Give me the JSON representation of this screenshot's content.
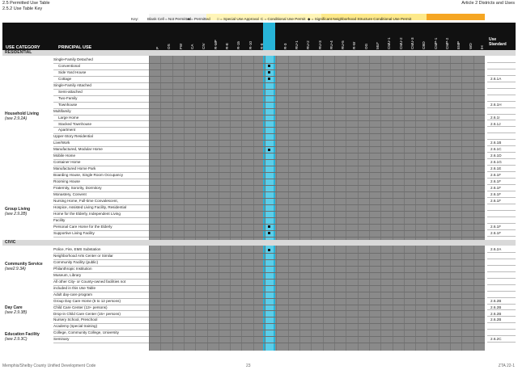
{
  "header": {
    "left_line1": "2.5 Permitted Use Table",
    "left_line2": "2.5.2 Use Table Key",
    "right": "Article 2 Districts and Uses"
  },
  "key": {
    "label": "Key:",
    "blank": "Blank Cell = Not Permitted",
    "permitted": "■ = Permitted",
    "special": "□ = Special Use Approval",
    "conditional": "C = Conditional Use Permit",
    "significant": "◆ = Significant Neighborhood Structure Conditional Use Permit"
  },
  "table_header": {
    "use_category": "USE CATEGORY",
    "principal_use": "PRINCIPAL USE",
    "use_standard": "Use Standard"
  },
  "zones": [
    "P",
    "OS",
    "FW",
    "CA",
    "CIV",
    "R-MP",
    "R-E",
    "R-15",
    "R-10",
    "R-8",
    "R-6",
    "R-3",
    "RU-1",
    "RU-2",
    "RU-3",
    "RU-4",
    "RU-5",
    "R-W",
    "OG",
    "MU*",
    "CMU-1",
    "CMU-2",
    "CMU-3",
    "CBD",
    "CMP-1",
    "CMP-2",
    "EMP",
    "WD",
    "IH"
  ],
  "sections": [
    "RESIDENTIAL",
    "CIVIC"
  ],
  "categories": [
    {
      "name": "Household Living",
      "ref": "(see 2.9.2A)"
    },
    {
      "name": "Group Living",
      "ref": "(see 2.9.2B)"
    },
    {
      "name": "Community Service",
      "ref": "(see2.9.3A)"
    },
    {
      "name": "Day Care",
      "ref": "(see 2.9.3B)"
    },
    {
      "name": "Education Facility",
      "ref": "(see 2.9.3C)"
    }
  ],
  "rows": [
    {
      "use": "Single-Family Detached",
      "std": ""
    },
    {
      "use": "Conventional",
      "std": ""
    },
    {
      "use": "Side Yard House",
      "std": ""
    },
    {
      "use": "Cottage",
      "std": "2.6.1A"
    },
    {
      "use": "Single-Family Attached",
      "std": ""
    },
    {
      "use": "Semi-attached",
      "std": ""
    },
    {
      "use": "Two-Family",
      "std": ""
    },
    {
      "use": "Townhouse",
      "std": "2.6.1H"
    },
    {
      "use": "Multifamily",
      "std": ""
    },
    {
      "use": "Large Home",
      "std": "2.6.1I"
    },
    {
      "use": "Stacked Townhouse",
      "std": "2.6.1J"
    },
    {
      "use": "Apartment",
      "std": ""
    },
    {
      "use": "Upper-Story Residential",
      "std": ""
    },
    {
      "use": "Live/Work",
      "std": "2.6.1B"
    },
    {
      "use": "Manufactured, Modular Home",
      "std": "2.6.1C"
    },
    {
      "use": "Mobile Home",
      "std": "2.6.1D"
    },
    {
      "use": "Container Home",
      "std": "2.6.1G"
    },
    {
      "use": "Manufactured Home Park",
      "std": "2.6.1E"
    },
    {
      "use": "Boarding House, Single Room Occupancy",
      "std": "2.6.1F"
    },
    {
      "use": "Rooming House",
      "std": "2.6.1F"
    },
    {
      "use": "Fraternity, Sorority, Dormitory",
      "std": "2.6.1F"
    },
    {
      "use": "Monastery, Convent",
      "std": "2.6.1F"
    },
    {
      "use": "Nursing Home, Full-time Convalescent,",
      "std": "2.6.1F"
    },
    {
      "use": "Hospice, Assisted Living Facility, Residential",
      "std": ""
    },
    {
      "use": "Home for the Elderly, Independent Living",
      "std": ""
    },
    {
      "use": "Facility",
      "std": ""
    },
    {
      "use": "Personal Care Home for the Elderly",
      "std": "2.6.1F"
    },
    {
      "use": "Supportive Living Facility",
      "std": "2.6.1F"
    },
    {
      "use": "Police, Fire, EMS Substation",
      "std": "2.6.2A"
    },
    {
      "use": "Neighborhood Arts Center or Similar",
      "std": ""
    },
    {
      "use": "Community Facility (public)",
      "std": ""
    },
    {
      "use": "Philanthropic Institution",
      "std": ""
    },
    {
      "use": "Museum, Library",
      "std": ""
    },
    {
      "use": "All other City- or County-owned facilities not",
      "std": ""
    },
    {
      "use": "included in this Use Table",
      "std": ""
    },
    {
      "use": "Adult day-care program",
      "std": ""
    },
    {
      "use": "Group Day Care Home (5 to 12 persons)",
      "std": "2.6.2B"
    },
    {
      "use": "Child Care Center (13+ persons)",
      "std": "2.6.2B"
    },
    {
      "use": "Drop-in Child Care Center (15+ persons)",
      "std": "2.6.2B"
    },
    {
      "use": "Nursery School, Preschool",
      "std": "2.6.2B"
    },
    {
      "use": "Academy (special training)",
      "std": ""
    },
    {
      "use": "College, Community College, University",
      "std": ""
    },
    {
      "use": "Seminary",
      "std": "2.6.2C"
    }
  ],
  "footer": {
    "left": "Memphis/Shelby County Unified Development Code",
    "center": "23",
    "right": "ZTA 22-1"
  },
  "colors": {
    "header_bg": "#111111",
    "grid": "#8a8a8a",
    "highlight": "#27b4d8",
    "yellow": "#fff3b0",
    "orange": "#f5a623"
  }
}
